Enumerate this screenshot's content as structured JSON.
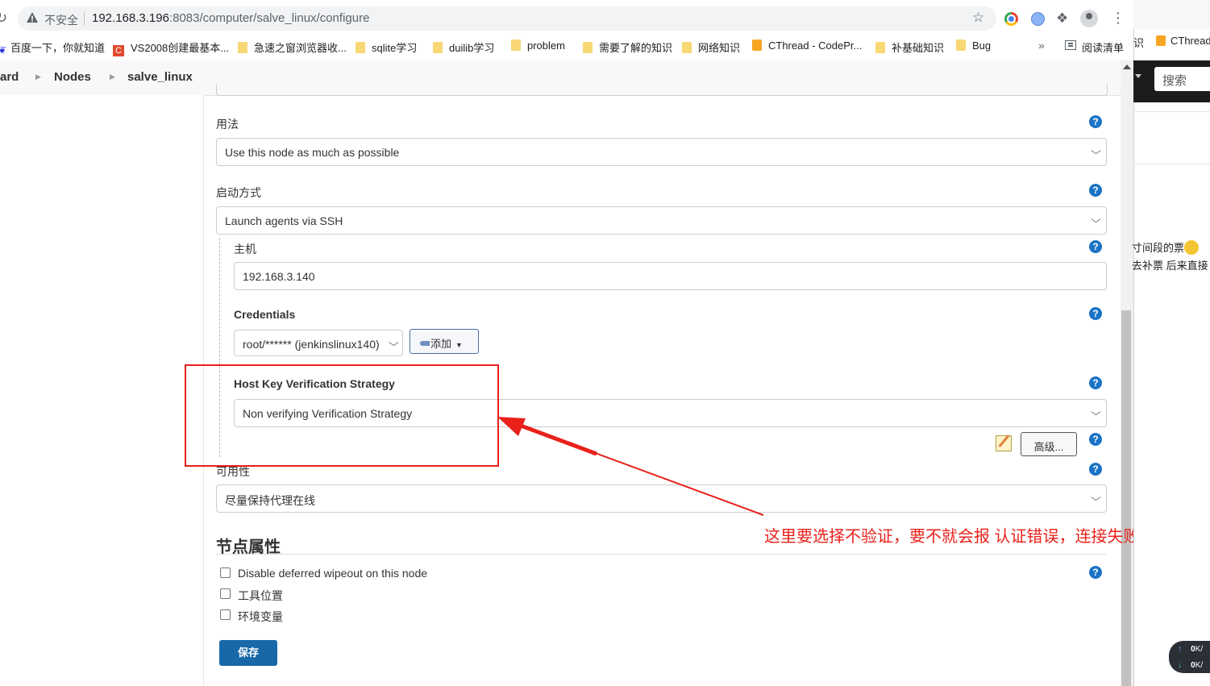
{
  "browser": {
    "insecure_label": "不安全",
    "url_host": "192.168.3.196",
    "url_rest": ":8083/computer/salve_linux/configure",
    "icons": [
      "reload-icon",
      "warning-icon",
      "star-icon",
      "chrome-ext-icon",
      "ext-icon",
      "puzzle-icon",
      "profile-icon",
      "menu-kebab-icon"
    ]
  },
  "bookmarks": {
    "items": [
      {
        "label": "百度一下，你就知道",
        "icon": "baidu-icon"
      },
      {
        "label": "VS2008创建最基本...",
        "icon": "csdn-icon"
      },
      {
        "label": "急速之窗浏览器收...",
        "icon": "folder-icon"
      },
      {
        "label": "sqlite学习",
        "icon": "folder-icon"
      },
      {
        "label": "duilib学习",
        "icon": "folder-icon"
      },
      {
        "label": "problem",
        "icon": "folder-icon"
      },
      {
        "label": "需要了解的知识",
        "icon": "folder-icon"
      },
      {
        "label": "网络知识",
        "icon": "folder-icon"
      },
      {
        "label": "CThread - CodePr...",
        "icon": "codeproject-icon"
      },
      {
        "label": "补基础知识",
        "icon": "folder-icon"
      },
      {
        "label": "Bug",
        "icon": "folder-icon"
      }
    ],
    "more": "»",
    "reading_list": "阅读清单"
  },
  "breadcrumb": {
    "items": [
      "ard",
      "Nodes",
      "salve_linux"
    ]
  },
  "form": {
    "usage_label": "用法",
    "usage_value": "Use this node as much as possible",
    "launch_label": "启动方式",
    "launch_value": "Launch agents via SSH",
    "host_label": "主机",
    "host_value": "192.168.3.140",
    "credentials_label": "Credentials",
    "credentials_value": "root/****** (jenkinslinux140)",
    "add_button": "添加",
    "hkvs_label": "Host Key Verification Strategy",
    "hkvs_value": "Non verifying Verification Strategy",
    "advanced_button": "高级...",
    "availability_label": "可用性",
    "availability_value": "尽量保持代理在线",
    "node_props_heading": "节点属性",
    "checkboxes": [
      {
        "label": "Disable deferred wipeout on this node",
        "checked": false
      },
      {
        "label": "工具位置",
        "checked": false
      },
      {
        "label": "环境变量",
        "checked": false
      }
    ],
    "save_button": "保存",
    "help_glyph": "?"
  },
  "annotation": {
    "text": "这里要选择不验证，要不就会报  认证错误，连接失败",
    "color": "#e8211b"
  },
  "side_window": {
    "bookmark_fragment_1": "识",
    "bookmark_fragment_2": "CThread",
    "search_placeholder": "搜索",
    "text_line_1": "寸间段的票",
    "text_line_2": "去补票  后来直接",
    "net_up": "0",
    "net_down": "0",
    "net_unit": "K/"
  },
  "colors": {
    "accent": "#1868a8",
    "help": "#1a73c6",
    "annotation": "#e8211b"
  }
}
